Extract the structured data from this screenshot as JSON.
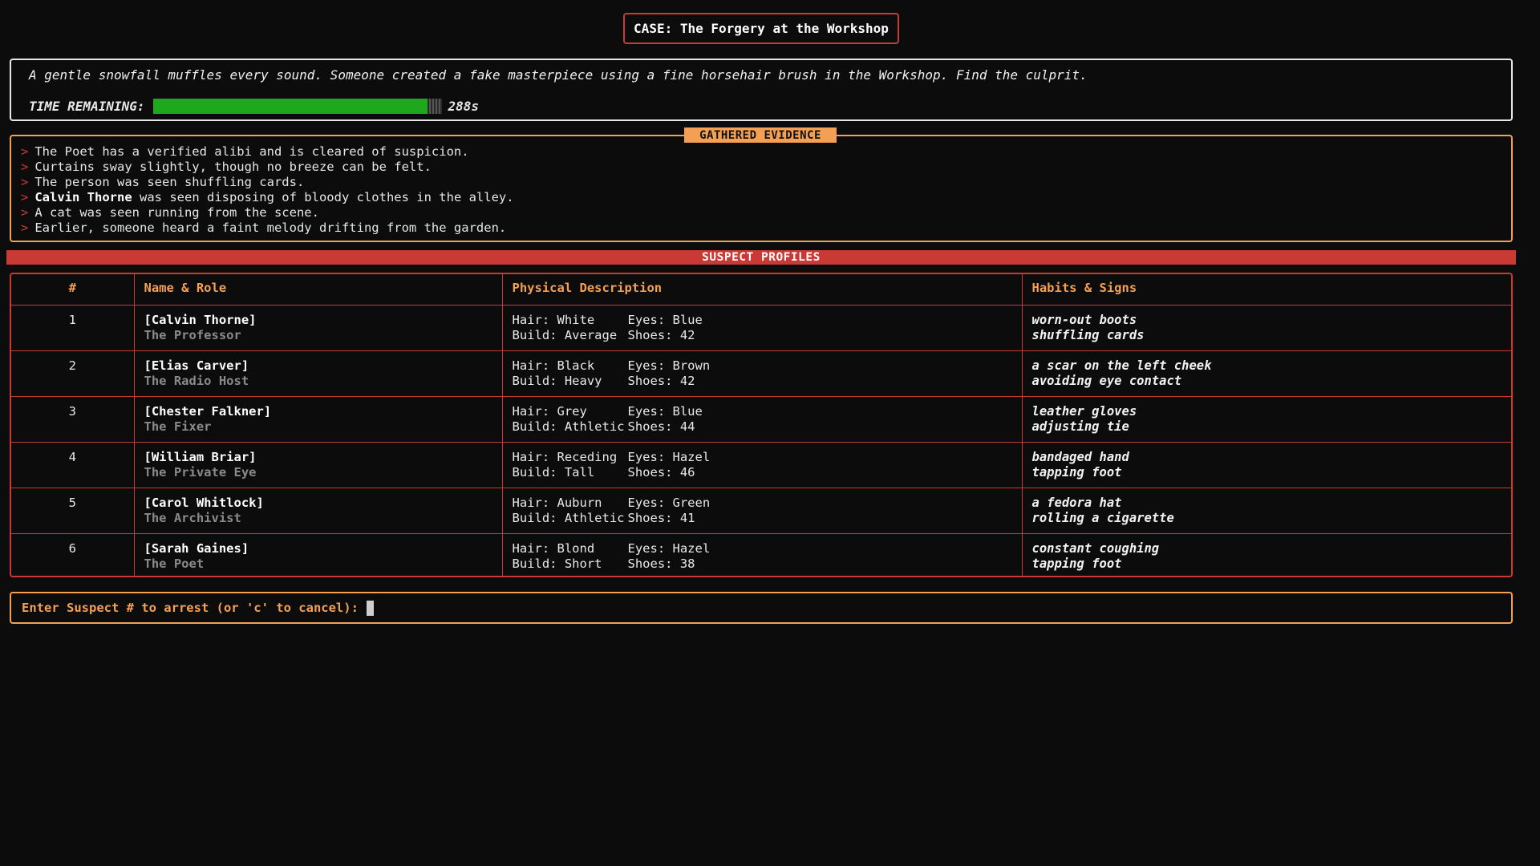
{
  "case": {
    "title": "CASE: The Forgery at the Workshop"
  },
  "intro": {
    "text": "A gentle snowfall muffles every sound. Someone created a fake masterpiece using a fine horsehair brush in the Workshop. Find the culprit.",
    "timer_label": "TIME REMAINING:",
    "timer_value": "288s",
    "timer_fraction": 0.95,
    "timer_color": "#1ea81e"
  },
  "evidence": {
    "header": "GATHERED EVIDENCE",
    "prompt": ">",
    "items": [
      {
        "bold": "",
        "text": "The Poet has a verified alibi and is cleared of suspicion."
      },
      {
        "bold": "",
        "text": "Curtains sway slightly, though no breeze can be felt."
      },
      {
        "bold": "",
        "text": "The person was seen shuffling cards."
      },
      {
        "bold": "Calvin Thorne",
        "text": " was seen disposing of bloody clothes in the alley."
      },
      {
        "bold": "",
        "text": "A cat was seen running from the scene."
      },
      {
        "bold": "",
        "text": "Earlier, someone heard a faint melody drifting from the garden."
      }
    ]
  },
  "suspects": {
    "banner": "SUSPECT PROFILES",
    "columns": [
      "#",
      "Name & Role",
      "Physical Description",
      "Habits & Signs"
    ],
    "rows": [
      {
        "num": "1",
        "name": "[Calvin Thorne]",
        "role": "The Professor",
        "hair": "Hair: White",
        "eyes": "Eyes: Blue",
        "build": "Build: Average",
        "shoes": "Shoes: 42",
        "habits": [
          "worn-out boots",
          "shuffling cards"
        ]
      },
      {
        "num": "2",
        "name": "[Elias Carver]",
        "role": "The Radio Host",
        "hair": "Hair: Black",
        "eyes": "Eyes: Brown",
        "build": "Build: Heavy",
        "shoes": "Shoes: 42",
        "habits": [
          "a scar on the left cheek",
          "avoiding eye contact"
        ]
      },
      {
        "num": "3",
        "name": "[Chester Falkner]",
        "role": "The Fixer",
        "hair": "Hair: Grey",
        "eyes": "Eyes: Blue",
        "build": "Build: Athletic",
        "shoes": "Shoes: 44",
        "habits": [
          "leather gloves",
          "adjusting tie"
        ]
      },
      {
        "num": "4",
        "name": "[William Briar]",
        "role": "The Private Eye",
        "hair": "Hair: Receding",
        "eyes": "Eyes: Hazel",
        "build": "Build: Tall",
        "shoes": "Shoes: 46",
        "habits": [
          "bandaged hand",
          "tapping foot"
        ]
      },
      {
        "num": "5",
        "name": "[Carol Whitlock]",
        "role": "The Archivist",
        "hair": "Hair: Auburn",
        "eyes": "Eyes: Green",
        "build": "Build: Athletic",
        "shoes": "Shoes: 41",
        "habits": [
          "a fedora hat",
          "rolling a cigarette"
        ]
      },
      {
        "num": "6",
        "name": "[Sarah Gaines]",
        "role": "The Poet",
        "hair": "Hair: Blond",
        "eyes": "Eyes: Hazel",
        "build": "Build: Short",
        "shoes": "Shoes: 38",
        "habits": [
          "constant coughing",
          "tapping foot"
        ]
      }
    ]
  },
  "input": {
    "prompt": "Enter Suspect # to arrest (or 'c' to cancel):"
  }
}
